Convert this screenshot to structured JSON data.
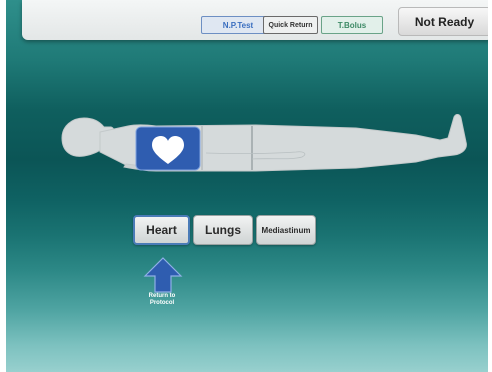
{
  "toolbar": {
    "np_test_label": "N.P.Test",
    "quick_return_label": "Quick Return",
    "t_bolus_label": "T.Bolus"
  },
  "status": {
    "label": "Not Ready"
  },
  "regions": {
    "heart_label": "Heart",
    "lungs_label": "Lungs",
    "mediastinum_label": "Mediastinum",
    "selected": "Heart"
  },
  "return": {
    "label_line1": "Return to",
    "label_line2": "Protocol"
  },
  "colors": {
    "accent_blue": "#2f5db0",
    "np_test_text": "#3b6fc0",
    "t_bolus_text": "#3e8a66"
  },
  "icons": {
    "heart": "heart-icon",
    "return": "arrow-up-icon"
  }
}
